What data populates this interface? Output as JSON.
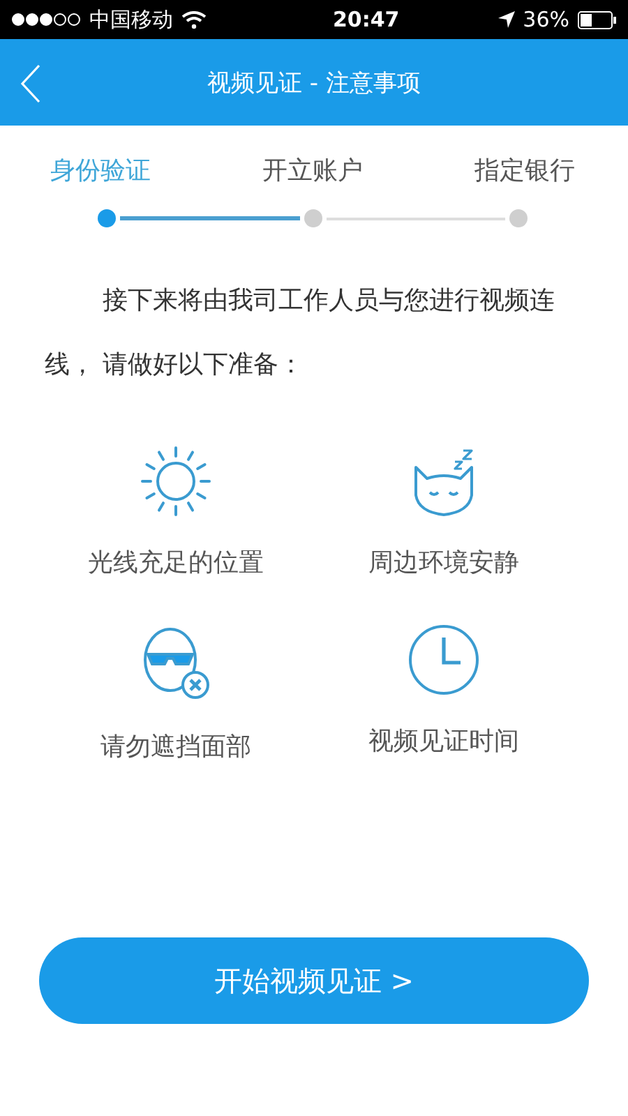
{
  "status_bar": {
    "carrier": "中国移动",
    "time": "20:47",
    "battery": "36%"
  },
  "header": {
    "title": "视频见证 - 注意事项"
  },
  "steps": [
    {
      "label": "身份验证",
      "selected": true
    },
    {
      "label": "开立账户",
      "selected": false
    },
    {
      "label": "指定银行",
      "selected": false
    }
  ],
  "intro": "接下来将由我司工作人员与您进行视频连线， 请做好以下准备：",
  "tips": [
    {
      "kind": "sun",
      "label": "光线充足的位置"
    },
    {
      "kind": "cat",
      "label": "周边环境安静"
    },
    {
      "kind": "face",
      "label": "请勿遮挡面部"
    },
    {
      "kind": "clock",
      "label": "视频见证时间"
    }
  ],
  "start_button": {
    "label": "开始视频见证 >"
  }
}
